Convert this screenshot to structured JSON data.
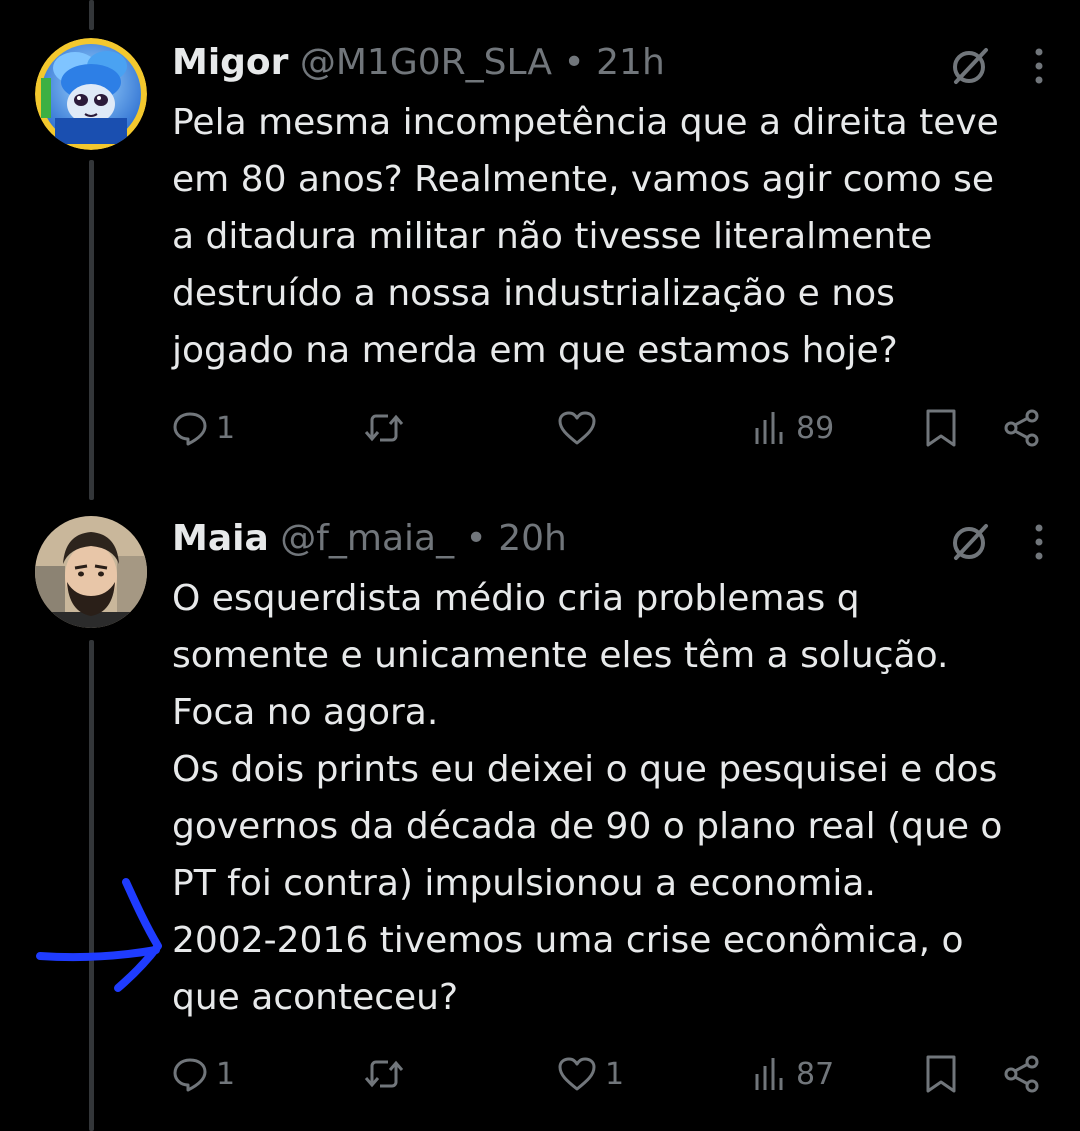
{
  "colors": {
    "background": "#000000",
    "text": "#e7e9ea",
    "muted": "#71767b",
    "thread_line": "#333639",
    "annotation": "#1f3cff"
  },
  "tweets": [
    {
      "name": "Migor",
      "handle": "@M1G0R_SLA",
      "separator": "•",
      "time": "21h",
      "lines": [
        "Pela mesma incompetência que a direita teve",
        "em 80 anos? Realmente, vamos agir como se",
        "a ditadura militar não tivesse literalmente",
        "destruído a nossa industrialização e nos",
        "jogado na merda em que estamos hoje?"
      ],
      "replies": "1",
      "retweets": "",
      "likes": "",
      "views": "89",
      "icons": {
        "grok": "grok-icon",
        "more": "more-icon",
        "reply": "reply-icon",
        "retweet": "retweet-icon",
        "like": "heart-icon",
        "views": "views-icon",
        "bookmark": "bookmark-icon",
        "share": "share-icon"
      }
    },
    {
      "name": "Maia",
      "handle": "@f_maia_",
      "separator": "•",
      "time": "20h",
      "lines": [
        "O esquerdista médio cria problemas q",
        "somente e unicamente eles têm a solução.",
        "Foca no agora.",
        "Os dois prints eu deixei o que pesquisei e dos",
        "governos da década de 90 o plano real (que o",
        "PT foi contra) impulsionou a economia.",
        "2002-2016 tivemos uma crise econômica, o",
        "que aconteceu?"
      ],
      "replies": "1",
      "retweets": "",
      "likes": "1",
      "views": "87",
      "icons": {
        "grok": "grok-icon",
        "more": "more-icon",
        "reply": "reply-icon",
        "retweet": "retweet-icon",
        "like": "heart-icon",
        "views": "views-icon",
        "bookmark": "bookmark-icon",
        "share": "share-icon"
      }
    }
  ],
  "annotation": {
    "icon": "hand-drawn-arrow",
    "color": "#1f3cff"
  }
}
